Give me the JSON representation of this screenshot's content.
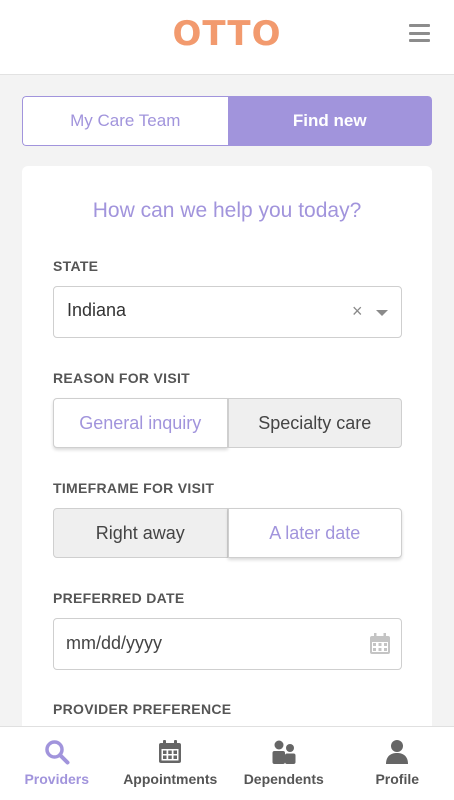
{
  "header": {
    "logo": "OTTO",
    "menu_icon": "hamburger-menu-icon"
  },
  "segmented": {
    "tabs": [
      {
        "label": "My Care Team",
        "selected": false
      },
      {
        "label": "Find new",
        "selected": true
      }
    ]
  },
  "form": {
    "title": "How can we help you today?",
    "state": {
      "label": "STATE",
      "value": "Indiana",
      "clear_icon": "×"
    },
    "reason": {
      "label": "REASON FOR VISIT",
      "options": [
        "General inquiry",
        "Specialty care"
      ],
      "selected": "General inquiry"
    },
    "timeframe": {
      "label": "TIMEFRAME FOR VISIT",
      "options": [
        "Right away",
        "A later date"
      ],
      "selected": "A later date"
    },
    "preferred_date": {
      "label": "PREFERRED DATE",
      "placeholder": "mm/dd/yyyy"
    },
    "provider_preference": {
      "label": "PROVIDER PREFERENCE"
    }
  },
  "bottom_nav": {
    "items": [
      {
        "label": "Providers",
        "icon": "search-icon",
        "active": true
      },
      {
        "label": "Appointments",
        "icon": "calendar-icon",
        "active": false
      },
      {
        "label": "Dependents",
        "icon": "people-icon",
        "active": false
      },
      {
        "label": "Profile",
        "icon": "person-icon",
        "active": false
      }
    ]
  },
  "colors": {
    "brand_orange": "#f29a6e",
    "accent_purple": "#a194dc",
    "nav_gray": "#666666"
  }
}
